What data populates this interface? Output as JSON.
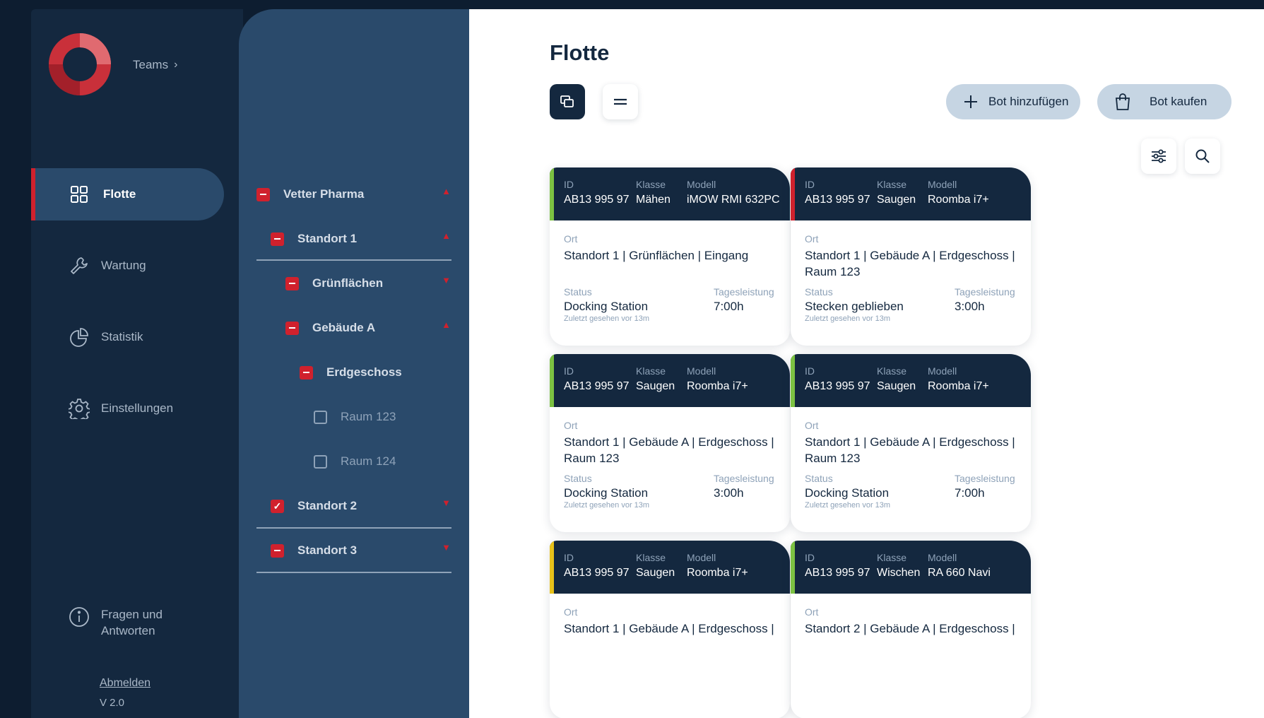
{
  "sidebar": {
    "teams_label": "Teams",
    "nav": [
      {
        "label": "Flotte",
        "icon": "grid-icon"
      },
      {
        "label": "Wartung",
        "icon": "wrench-icon"
      },
      {
        "label": "Statistik",
        "icon": "pie-chart-icon"
      },
      {
        "label": "Einstellungen",
        "icon": "gear-icon"
      }
    ],
    "faq_label": "Fragen und Antworten",
    "logout_label": "Abmelden",
    "version": "V 2.0"
  },
  "tree": {
    "items": [
      {
        "label": "Vetter Pharma",
        "state": "partial",
        "expanded": true
      },
      {
        "label": "Standort 1",
        "state": "partial",
        "expanded": true
      },
      {
        "label": "Grünflächen",
        "state": "partial",
        "expanded": false
      },
      {
        "label": "Gebäude A",
        "state": "partial",
        "expanded": true
      },
      {
        "label": "Erdgeschoss",
        "state": "partial"
      },
      {
        "label": "Raum 123",
        "state": "unchecked"
      },
      {
        "label": "Raum 124",
        "state": "unchecked"
      },
      {
        "label": "Standort 2",
        "state": "checked",
        "expanded": false
      },
      {
        "label": "Standort 3",
        "state": "partial",
        "expanded": false
      }
    ]
  },
  "main": {
    "title": "Flotte",
    "add_button": "Bot hinzufügen",
    "buy_button": "Bot kaufen",
    "field_labels": {
      "id": "ID",
      "klasse": "Klasse",
      "modell": "Modell",
      "ort": "Ort",
      "status": "Status",
      "tagesleistung": "Tagesleistung"
    },
    "cards": [
      {
        "id": "AB13 995 97",
        "klasse": "Mähen",
        "modell": "iMOW RMI 632PC",
        "ort": "Standort 1 | Grünflächen | Eingang",
        "status": "Docking Station",
        "seen": "Zuletzt gesehen vor 13m",
        "tagesleistung": "7:00h",
        "strip_color": "#7cc242"
      },
      {
        "id": "AB13 995 97",
        "klasse": "Saugen",
        "modell": "Roomba i7+",
        "ort": "Standort 1 | Gebäude A | Erdgeschoss | Raum 123",
        "status": "Stecken geblieben",
        "seen": "Zuletzt gesehen vor 13m",
        "tagesleistung": "3:00h",
        "strip_color": "#d0212d"
      },
      {
        "id": "AB13 995 97",
        "klasse": "Saugen",
        "modell": "Roomba i7+",
        "ort": "Standort 1 | Gebäude A | Erdgeschoss | Raum 123",
        "status": "Docking Station",
        "seen": "Zuletzt gesehen vor 13m",
        "tagesleistung": "3:00h",
        "strip_color": "#7cc242"
      },
      {
        "id": "AB13 995 97",
        "klasse": "Saugen",
        "modell": "Roomba i7+",
        "ort": "Standort 1 | Gebäude A | Erdgeschoss | Raum 123",
        "status": "Docking Station",
        "seen": "Zuletzt gesehen vor 13m",
        "tagesleistung": "7:00h",
        "strip_color": "#7cc242"
      },
      {
        "id": "AB13 995 97",
        "klasse": "Saugen",
        "modell": "Roomba i7+",
        "ort": "Standort 1 | Gebäude A | Erdgeschoss |",
        "status": "",
        "seen": "",
        "tagesleistung": "",
        "strip_color": "#e8c21a"
      },
      {
        "id": "AB13 995 97",
        "klasse": "Wischen",
        "modell": "RA 660 Navi",
        "ort": "Standort 2 | Gebäude A | Erdgeschoss |",
        "status": "",
        "seen": "",
        "tagesleistung": "",
        "strip_color": "#7cc242"
      }
    ]
  },
  "colors": {
    "brand_red": "#d0212d",
    "navy": "#14283f",
    "panel_blue": "#2a4a6b",
    "status_green": "#7cc242",
    "status_yellow": "#e8c21a"
  }
}
